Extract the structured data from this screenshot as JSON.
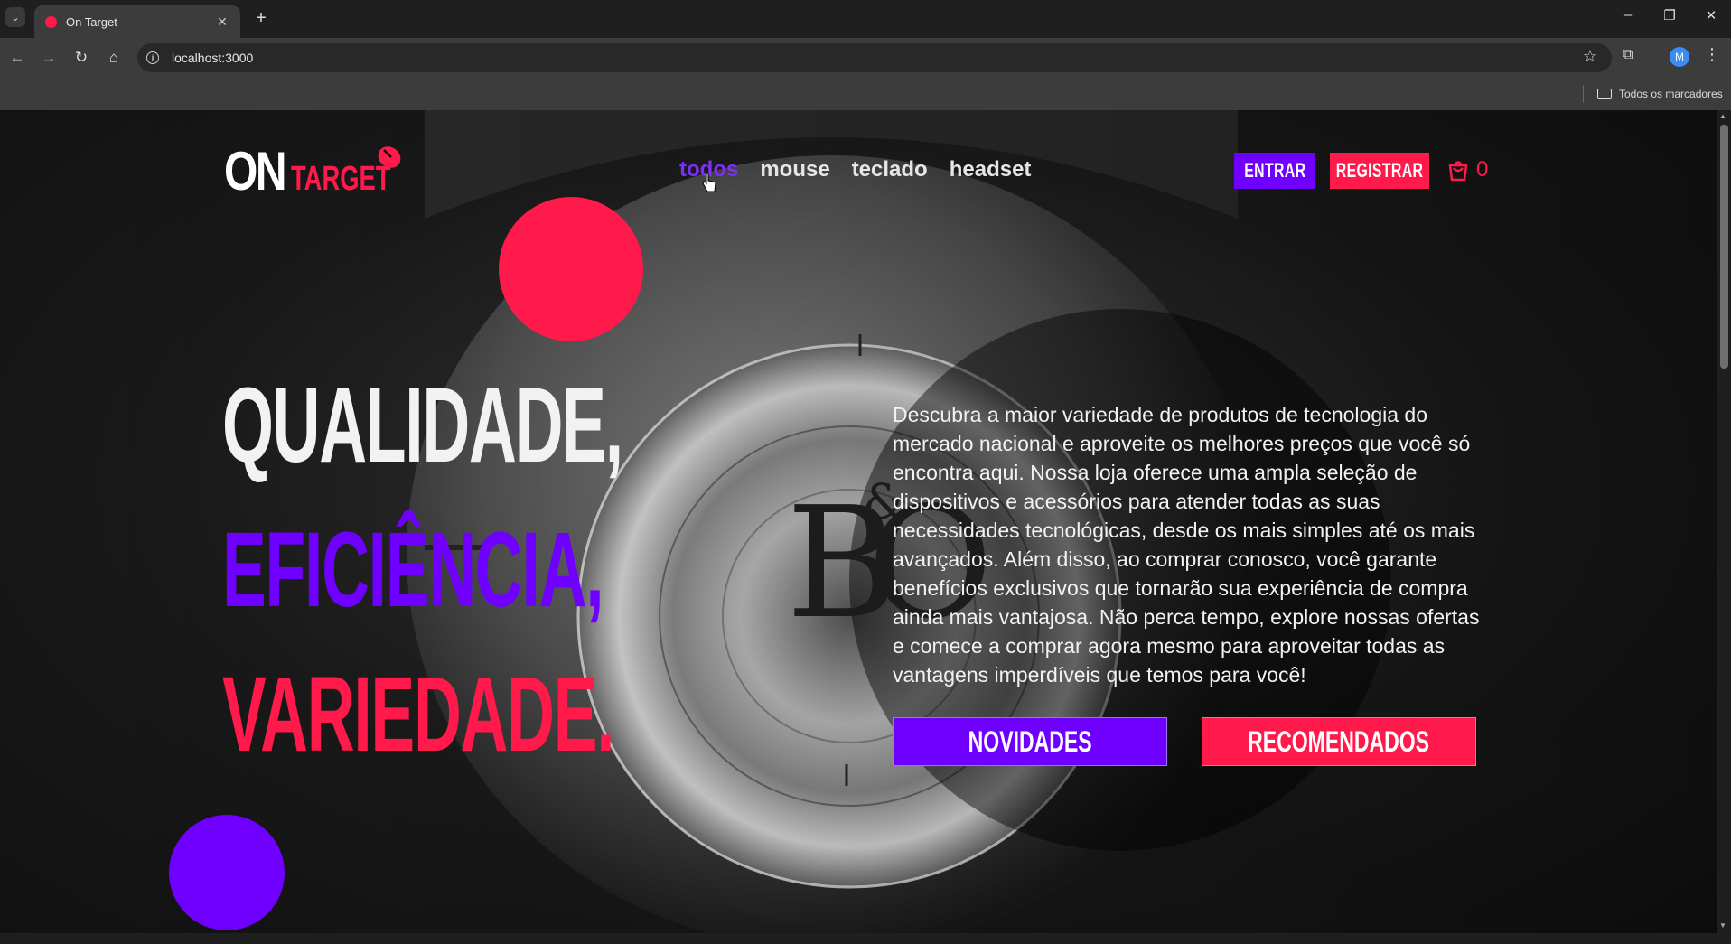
{
  "browser": {
    "tab_title": "On Target",
    "tab_close": "✕",
    "new_tab": "+",
    "url": "localhost:3000",
    "bookmarks_folder": "Todos os marcadores",
    "profile_initial": "M"
  },
  "site": {
    "logo_on": "ON",
    "logo_target": "TARGET",
    "nav": [
      "todos",
      "mouse",
      "teclado",
      "headset"
    ],
    "active_nav": "todos",
    "entrar": "ENTRAR",
    "registrar": "REGISTRAR",
    "cart_count": "0"
  },
  "hero": {
    "line1": "QUALIDADE,",
    "line2": "EFICIÊNCIA,",
    "line3": "VARIEDADE.",
    "description": "Descubra a maior variedade de produtos de tecnologia do mercado nacional e aproveite os melhores preços que você só encontra aqui. Nossa loja oferece uma ampla seleção de dispositivos e acessórios para atender todas as suas necessidades tecnológicas, desde os mais simples até os mais avançados. Além disso, ao comprar conosco, você garante benefícios exclusivos que tornarão sua experiência de compra ainda mais vantajosa. Não perca tempo, explore nossas ofertas e comece a comprar agora mesmo para aproveitar todas as vantagens imperdíveis que temos para você!",
    "btn_novidades": "NOVIDADES",
    "btn_recomendados": "RECOMENDADOS",
    "background_brand_mark": "B&O"
  },
  "colors": {
    "accent_purple": "#6f00ff",
    "accent_red": "#ff1a4b",
    "background": "#111111"
  }
}
